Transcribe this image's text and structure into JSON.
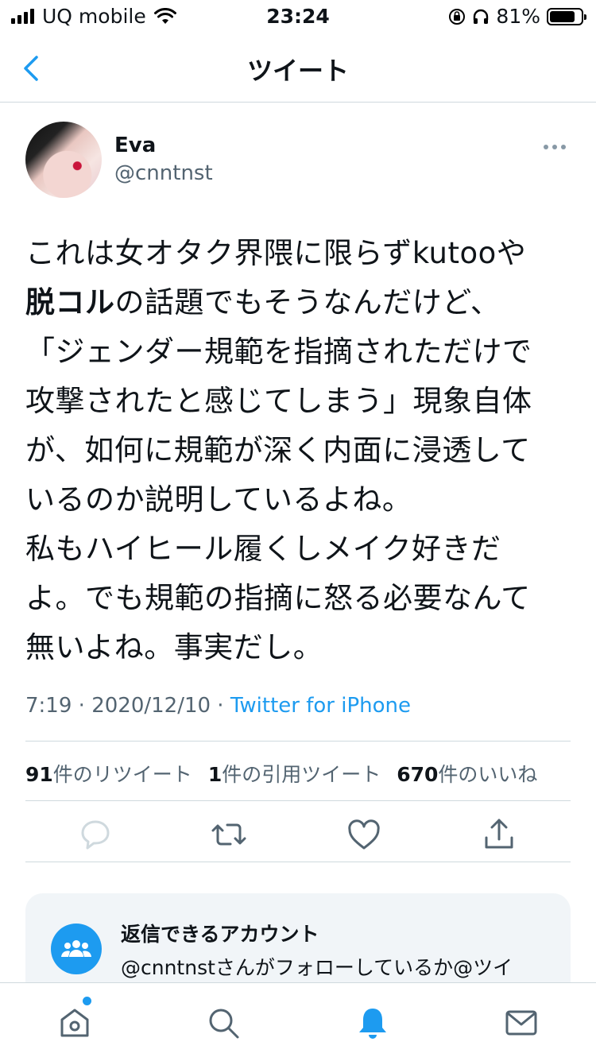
{
  "status_bar": {
    "carrier": "UQ mobile",
    "time": "23:24",
    "battery": "81%",
    "battery_level": 0.81
  },
  "nav": {
    "title": "ツイート"
  },
  "tweet": {
    "name": "Eva",
    "handle": "@cnntnst",
    "lines": [
      {
        "text": "これは女オタク界隈に限らずkutooや"
      },
      {
        "bold": "脱コル",
        "rest": "の話題でもそうなんだけど、"
      },
      {
        "text": "「ジェンダー規範を指摘されただけで"
      },
      {
        "text": "攻撃されたと感じてしまう」現象自体"
      },
      {
        "text": "が、如何に規範が深く内面に浸透して"
      },
      {
        "text": "いるのか説明しているよね。"
      },
      {
        "text": "私もハイヒール履くしメイク好きだ"
      },
      {
        "text": "よ。でも規範の指摘に怒る必要なんて"
      },
      {
        "text": "無いよね。事実だし。"
      }
    ],
    "time": "7:19",
    "date": "2020/12/10",
    "source": "Twitter for iPhone",
    "stats": {
      "retweets": "91",
      "retweets_label": "件のリツイート",
      "quotes": "1",
      "quotes_label": "件の引用ツイート",
      "likes": "670",
      "likes_label": "件のいいね"
    }
  },
  "reply_card": {
    "title": "返信できるアカウント",
    "description": "@cnntnstさんがフォローしているか@ツイ"
  },
  "colors": {
    "accent": "#1d9bf0",
    "secondary_text": "#536471",
    "card_bg": "#f1f5f8"
  },
  "icons": [
    "chevron-left-icon",
    "more-icon",
    "reply-icon",
    "retweet-icon",
    "like-icon",
    "share-icon",
    "people-icon",
    "home-icon",
    "search-icon",
    "notifications-icon",
    "messages-icon"
  ]
}
